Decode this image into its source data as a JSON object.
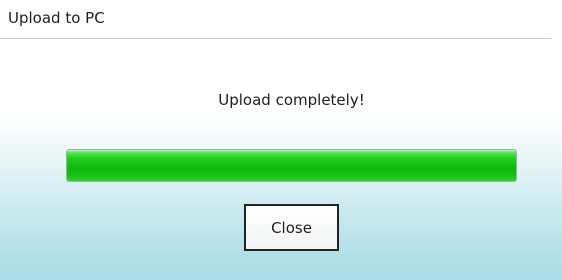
{
  "dialog": {
    "title": "Upload to PC",
    "message": "Upload completely!",
    "progress": {
      "percent": 100,
      "color": "#11c011"
    },
    "close_label": "Close"
  },
  "colors": {
    "background_bottom": "#a9dce5",
    "title_divider": "#c8c8c8",
    "button_border": "#222222"
  }
}
